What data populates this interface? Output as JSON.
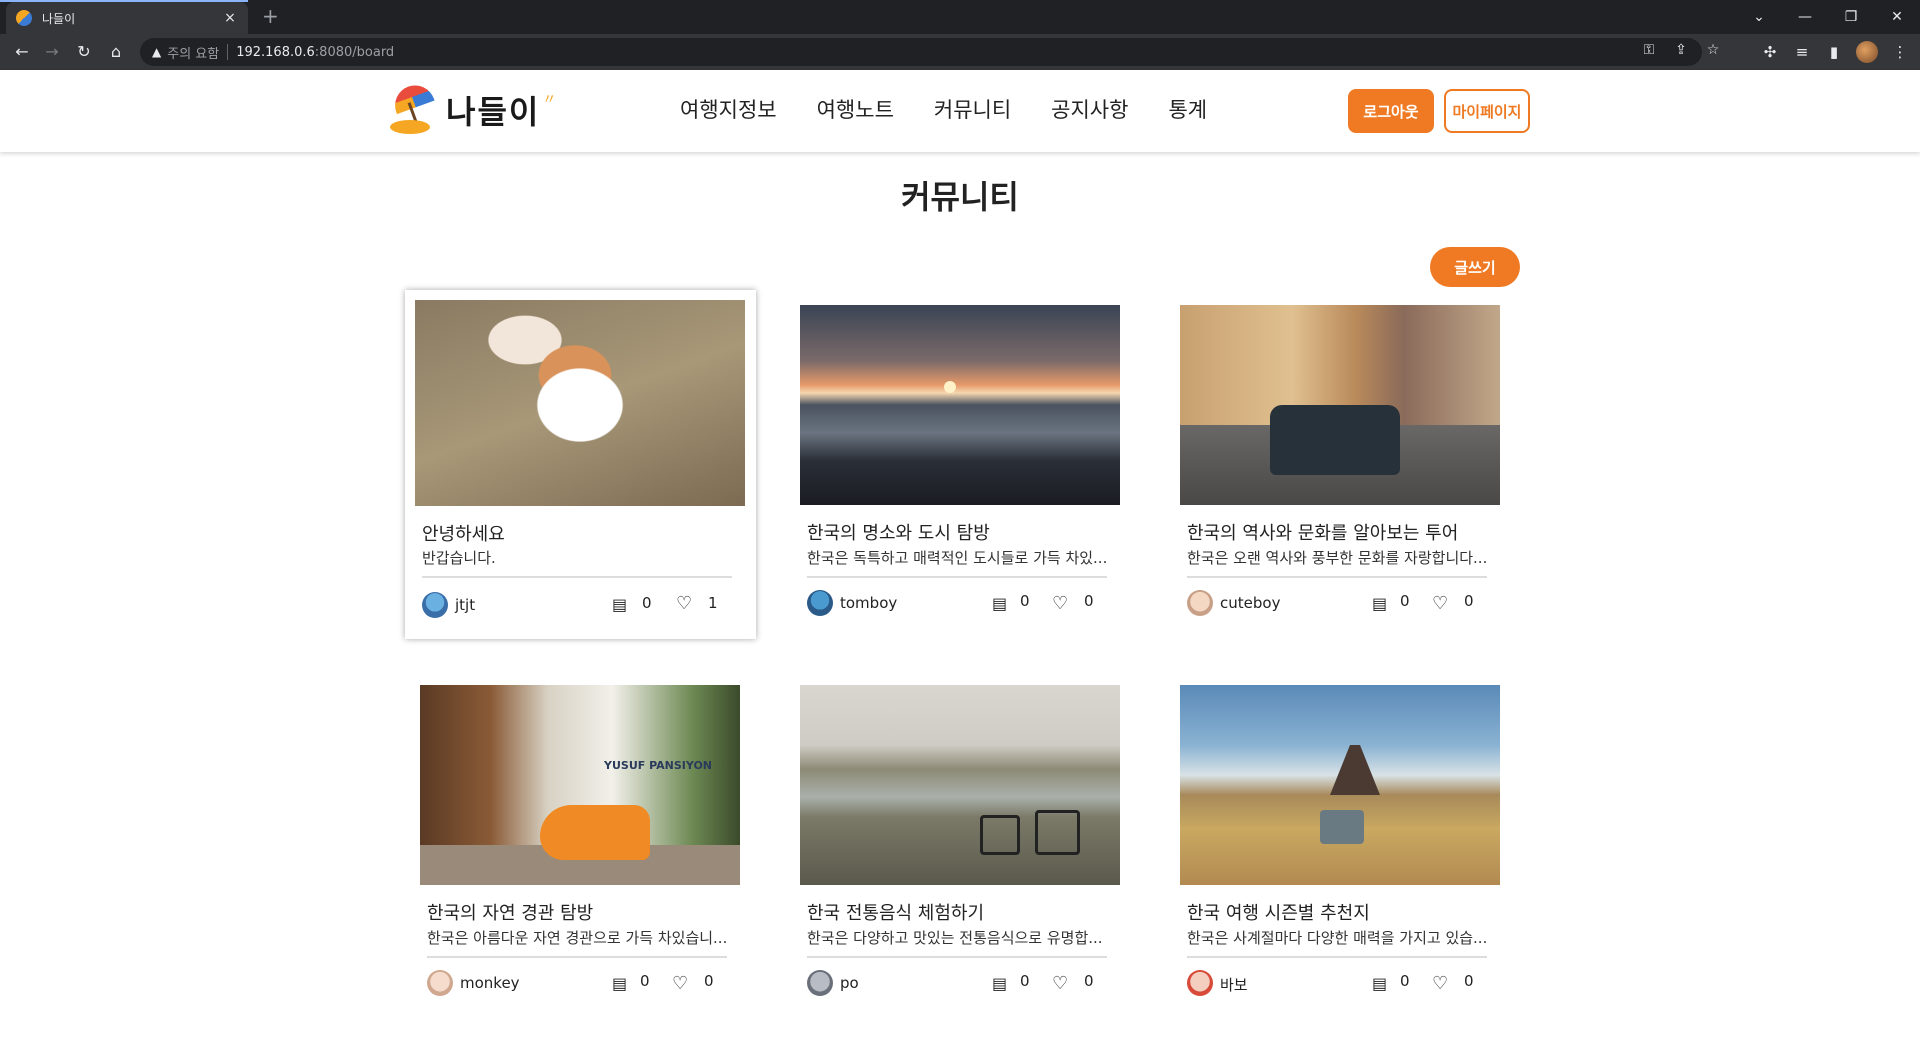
{
  "browser": {
    "tab_title": "나들이",
    "tab_close": "×",
    "new_tab": "+",
    "url_warning": "주의 요함",
    "url_host": "192.168.0.6",
    "url_path": ":8080/board",
    "window_controls": [
      "⌄",
      "—",
      "❐",
      "✕"
    ]
  },
  "header": {
    "logo_text": "나들이",
    "nav": [
      "여행지정보",
      "여행노트",
      "커뮤니티",
      "공지사항",
      "통계"
    ],
    "logout_label": "로그아웃",
    "mypage_label": "마이페이지"
  },
  "page": {
    "title": "커뮤니티",
    "write_label": "글쓰기"
  },
  "posts": [
    {
      "title": "안녕하세요",
      "desc": "반갑습니다.",
      "author": "jtjt",
      "comments": "0",
      "likes": "1"
    },
    {
      "title": "한국의 명소와 도시 탐방",
      "desc": "한국은 독특하고 매력적인 도시들로 가득 차있...",
      "author": "tomboy",
      "comments": "0",
      "likes": "0"
    },
    {
      "title": "한국의 역사와 문화를 알아보는 투어",
      "desc": "한국은 오랜 역사와 풍부한 문화를 자랑합니다...",
      "author": "cuteboy",
      "comments": "0",
      "likes": "0"
    },
    {
      "title": "한국의 자연 경관 탐방",
      "desc": "한국은 아름다운 자연 경관으로 가득 차있습니...",
      "author": "monkey",
      "comments": "0",
      "likes": "0"
    },
    {
      "title": "한국 전통음식 체험하기",
      "desc": "한국은 다양하고 맛있는 전통음식으로 유명합...",
      "author": "po",
      "comments": "0",
      "likes": "0"
    },
    {
      "title": "한국 여행 시즌별 추천지",
      "desc": "한국은 사계절마다 다양한 매력을 가지고 있습...",
      "author": "바보",
      "comments": "0",
      "likes": "0"
    }
  ],
  "scooter_sign": "YUSUF PANSIYON",
  "colors": {
    "accent": "#ef7a23",
    "chrome_dark": "#202124"
  },
  "icons": {
    "comment": "comment-icon",
    "like": "heart-icon"
  }
}
